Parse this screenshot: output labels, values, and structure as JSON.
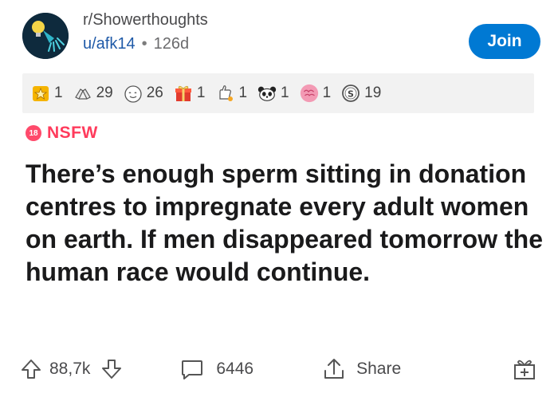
{
  "post": {
    "subreddit": "r/Showerthoughts",
    "author": "u/afk14",
    "separator": "•",
    "age": "126d",
    "join_label": "Join",
    "nsfw_badge": "18",
    "nsfw_label": "NSFW",
    "title": "There’s enough sperm sitting in donation centres to impregnate every adult women on earth. If men disappeared tomorrow the human race would continue."
  },
  "awards": [
    {
      "icon": "gold-star-award-icon",
      "count": "1"
    },
    {
      "icon": "helpful-hands-award-icon",
      "count": "29"
    },
    {
      "icon": "wholesome-face-award-icon",
      "count": "26"
    },
    {
      "icon": "gift-box-award-icon",
      "count": "1"
    },
    {
      "icon": "bravo-hand-award-icon",
      "count": "1"
    },
    {
      "icon": "panda-face-award-icon",
      "count": "1"
    },
    {
      "icon": "brain-award-icon",
      "count": "1"
    },
    {
      "icon": "silver-coin-award-icon",
      "count": "19"
    }
  ],
  "actions": {
    "votes": "88,7k",
    "comments": "6446",
    "share": "Share"
  },
  "colors": {
    "join": "#0079d3",
    "nsfw": "#ff3b5c",
    "user_link": "#1f5aa8",
    "awards_bg": "#f2f2f2"
  }
}
